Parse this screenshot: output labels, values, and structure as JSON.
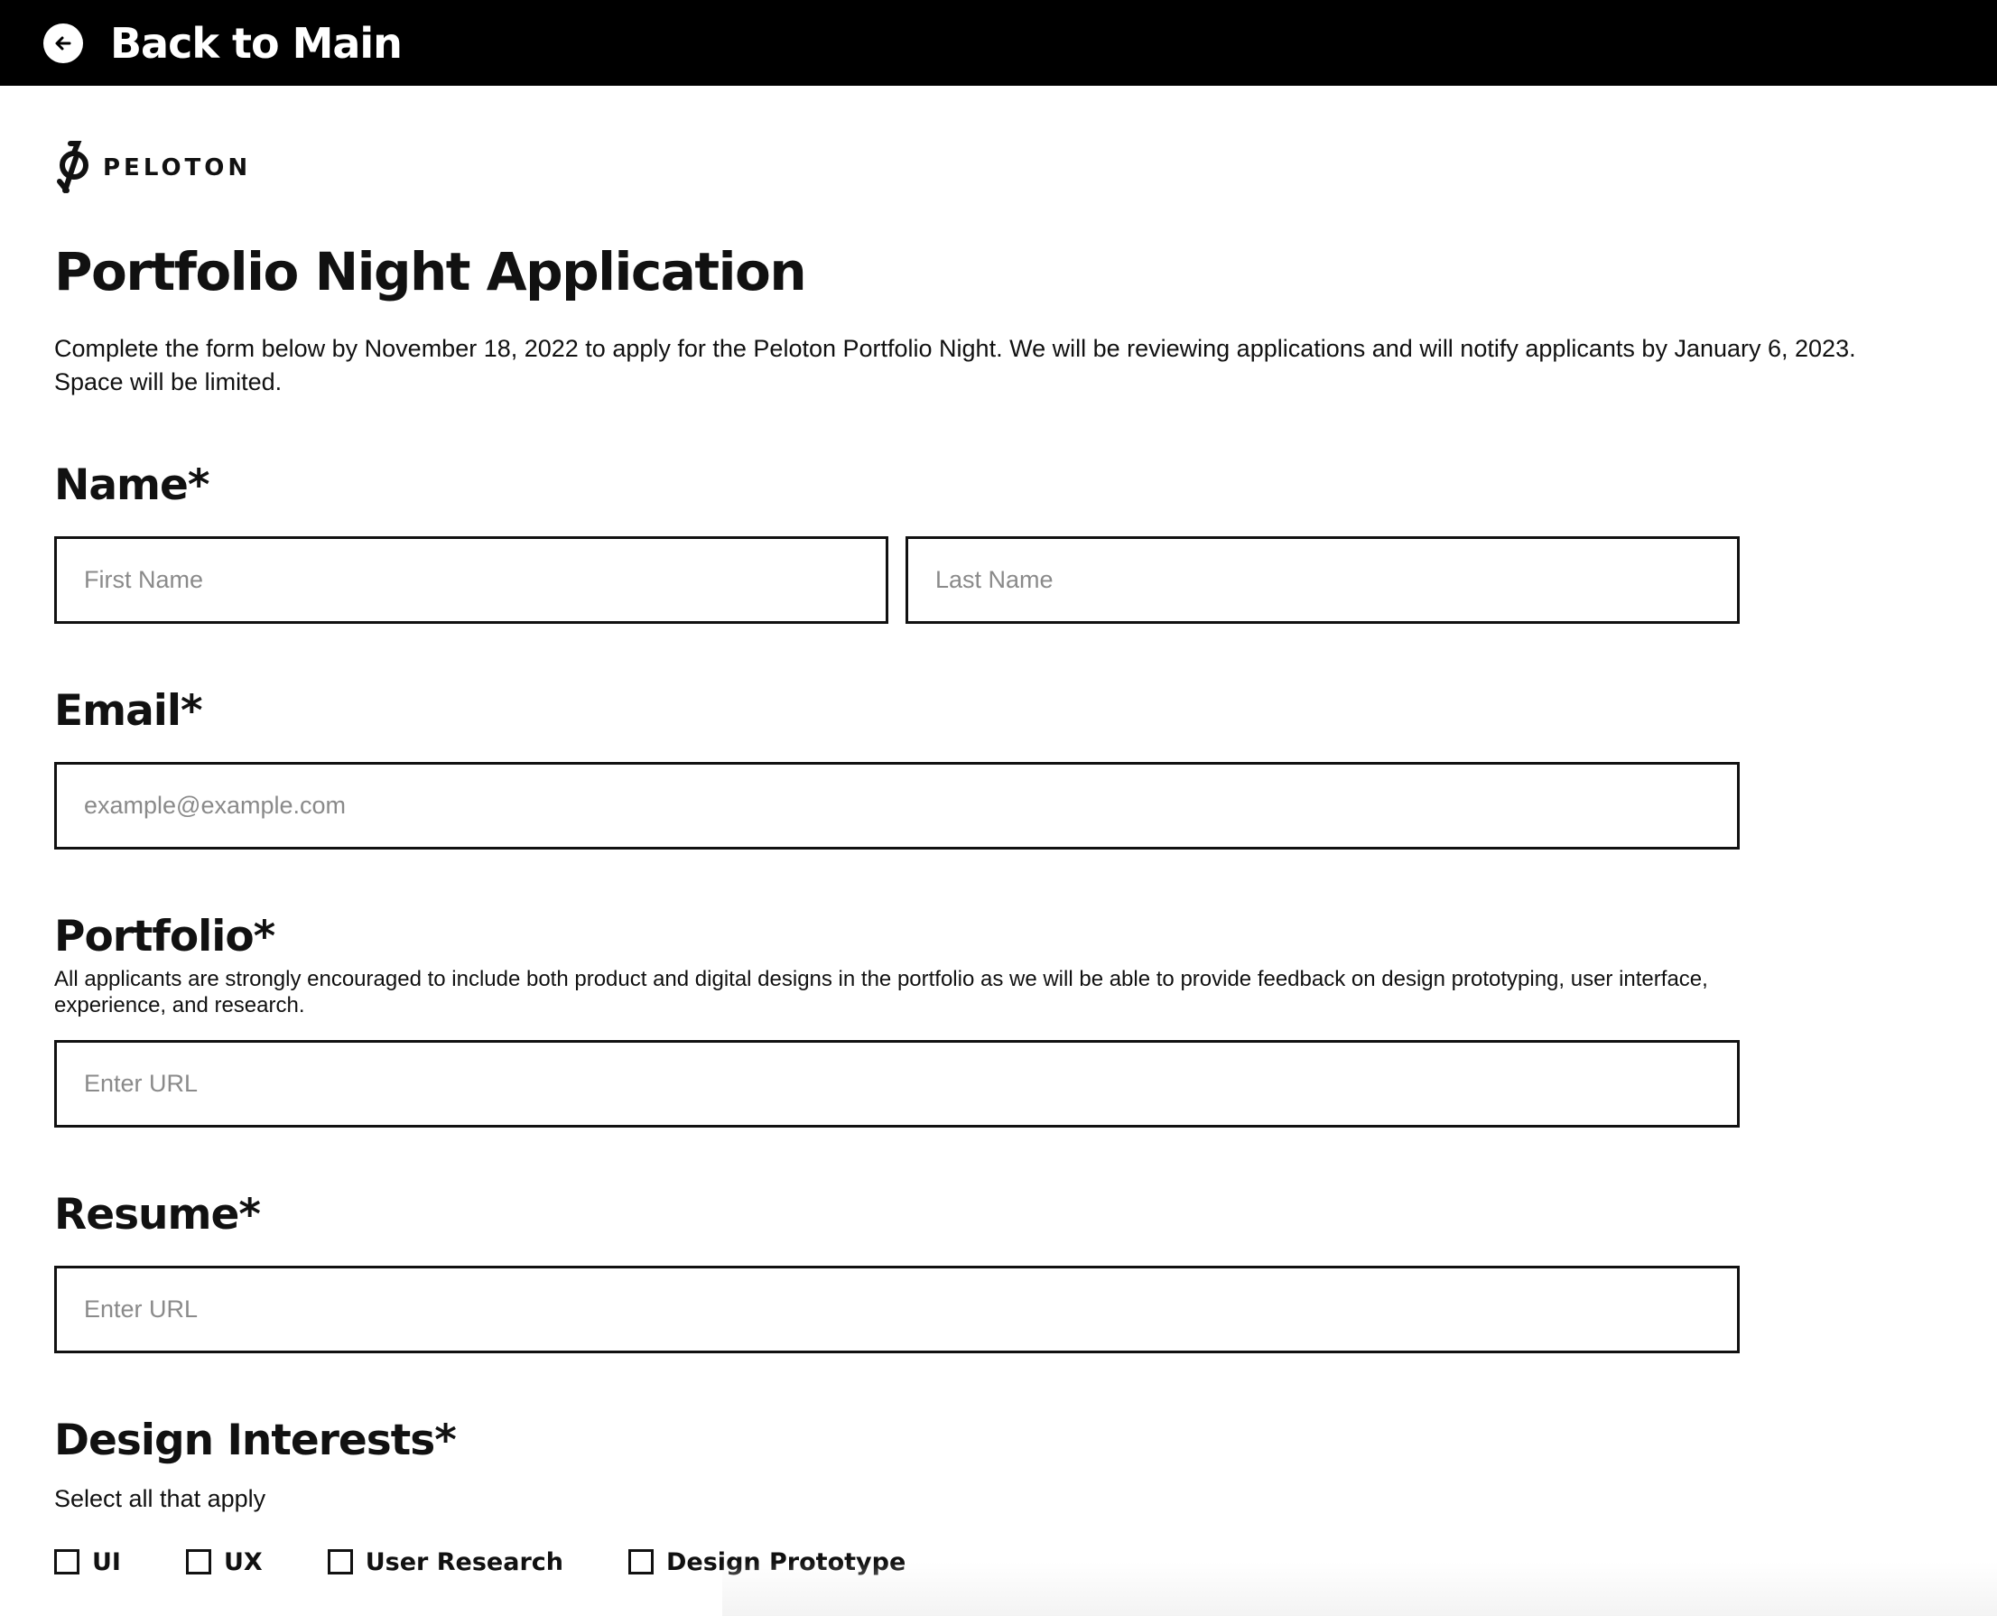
{
  "topbar": {
    "back_label": "Back to Main",
    "back_icon": "arrow-left-circle-icon"
  },
  "logo": {
    "text": "PELOTON",
    "icon": "peloton-logo-icon"
  },
  "page": {
    "title": "Portfolio Night Application",
    "intro": "Complete the form below by November 18, 2022 to apply for the Peloton Portfolio Night. We will be reviewing applications and will notify applicants by January 6, 2023. Space will be limited."
  },
  "form": {
    "name": {
      "label": "Name*",
      "first_placeholder": "First Name",
      "last_placeholder": "Last Name",
      "first_value": "",
      "last_value": ""
    },
    "email": {
      "label": "Email*",
      "placeholder": "example@example.com",
      "value": ""
    },
    "portfolio": {
      "label": "Portfolio*",
      "helper": "All applicants are strongly encouraged to include both product and digital designs in the portfolio as we will be able to provide feedback on design prototyping, user interface, experience, and research.",
      "placeholder": "Enter URL",
      "value": ""
    },
    "resume": {
      "label": "Resume*",
      "placeholder": "Enter URL",
      "value": ""
    },
    "design_interests": {
      "label": "Design Interests*",
      "helper": "Select all that apply",
      "options": [
        {
          "label": "UI",
          "checked": false
        },
        {
          "label": "UX",
          "checked": false
        },
        {
          "label": "User Research",
          "checked": false
        },
        {
          "label": "Design Prototype",
          "checked": false
        }
      ]
    }
  },
  "colors": {
    "topbar_bg": "#000000",
    "text": "#111111",
    "placeholder": "#8a8a8a",
    "border": "#111111"
  }
}
